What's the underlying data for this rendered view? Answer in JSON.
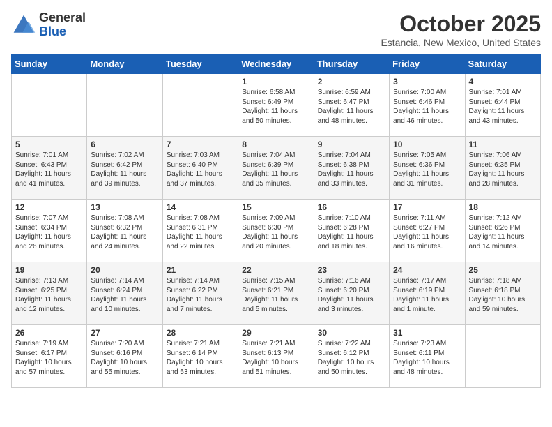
{
  "header": {
    "logo": {
      "line1": "General",
      "line2": "Blue"
    },
    "title": "October 2025",
    "subtitle": "Estancia, New Mexico, United States"
  },
  "weekdays": [
    "Sunday",
    "Monday",
    "Tuesday",
    "Wednesday",
    "Thursday",
    "Friday",
    "Saturday"
  ],
  "weeks": [
    [
      {
        "day": "",
        "sunrise": "",
        "sunset": "",
        "daylight": ""
      },
      {
        "day": "",
        "sunrise": "",
        "sunset": "",
        "daylight": ""
      },
      {
        "day": "",
        "sunrise": "",
        "sunset": "",
        "daylight": ""
      },
      {
        "day": "1",
        "sunrise": "6:58 AM",
        "sunset": "6:49 PM",
        "daylight": "11 hours and 50 minutes."
      },
      {
        "day": "2",
        "sunrise": "6:59 AM",
        "sunset": "6:47 PM",
        "daylight": "11 hours and 48 minutes."
      },
      {
        "day": "3",
        "sunrise": "7:00 AM",
        "sunset": "6:46 PM",
        "daylight": "11 hours and 46 minutes."
      },
      {
        "day": "4",
        "sunrise": "7:01 AM",
        "sunset": "6:44 PM",
        "daylight": "11 hours and 43 minutes."
      }
    ],
    [
      {
        "day": "5",
        "sunrise": "7:01 AM",
        "sunset": "6:43 PM",
        "daylight": "11 hours and 41 minutes."
      },
      {
        "day": "6",
        "sunrise": "7:02 AM",
        "sunset": "6:42 PM",
        "daylight": "11 hours and 39 minutes."
      },
      {
        "day": "7",
        "sunrise": "7:03 AM",
        "sunset": "6:40 PM",
        "daylight": "11 hours and 37 minutes."
      },
      {
        "day": "8",
        "sunrise": "7:04 AM",
        "sunset": "6:39 PM",
        "daylight": "11 hours and 35 minutes."
      },
      {
        "day": "9",
        "sunrise": "7:04 AM",
        "sunset": "6:38 PM",
        "daylight": "11 hours and 33 minutes."
      },
      {
        "day": "10",
        "sunrise": "7:05 AM",
        "sunset": "6:36 PM",
        "daylight": "11 hours and 31 minutes."
      },
      {
        "day": "11",
        "sunrise": "7:06 AM",
        "sunset": "6:35 PM",
        "daylight": "11 hours and 28 minutes."
      }
    ],
    [
      {
        "day": "12",
        "sunrise": "7:07 AM",
        "sunset": "6:34 PM",
        "daylight": "11 hours and 26 minutes."
      },
      {
        "day": "13",
        "sunrise": "7:08 AM",
        "sunset": "6:32 PM",
        "daylight": "11 hours and 24 minutes."
      },
      {
        "day": "14",
        "sunrise": "7:08 AM",
        "sunset": "6:31 PM",
        "daylight": "11 hours and 22 minutes."
      },
      {
        "day": "15",
        "sunrise": "7:09 AM",
        "sunset": "6:30 PM",
        "daylight": "11 hours and 20 minutes."
      },
      {
        "day": "16",
        "sunrise": "7:10 AM",
        "sunset": "6:28 PM",
        "daylight": "11 hours and 18 minutes."
      },
      {
        "day": "17",
        "sunrise": "7:11 AM",
        "sunset": "6:27 PM",
        "daylight": "11 hours and 16 minutes."
      },
      {
        "day": "18",
        "sunrise": "7:12 AM",
        "sunset": "6:26 PM",
        "daylight": "11 hours and 14 minutes."
      }
    ],
    [
      {
        "day": "19",
        "sunrise": "7:13 AM",
        "sunset": "6:25 PM",
        "daylight": "11 hours and 12 minutes."
      },
      {
        "day": "20",
        "sunrise": "7:14 AM",
        "sunset": "6:24 PM",
        "daylight": "11 hours and 10 minutes."
      },
      {
        "day": "21",
        "sunrise": "7:14 AM",
        "sunset": "6:22 PM",
        "daylight": "11 hours and 7 minutes."
      },
      {
        "day": "22",
        "sunrise": "7:15 AM",
        "sunset": "6:21 PM",
        "daylight": "11 hours and 5 minutes."
      },
      {
        "day": "23",
        "sunrise": "7:16 AM",
        "sunset": "6:20 PM",
        "daylight": "11 hours and 3 minutes."
      },
      {
        "day": "24",
        "sunrise": "7:17 AM",
        "sunset": "6:19 PM",
        "daylight": "11 hours and 1 minute."
      },
      {
        "day": "25",
        "sunrise": "7:18 AM",
        "sunset": "6:18 PM",
        "daylight": "10 hours and 59 minutes."
      }
    ],
    [
      {
        "day": "26",
        "sunrise": "7:19 AM",
        "sunset": "6:17 PM",
        "daylight": "10 hours and 57 minutes."
      },
      {
        "day": "27",
        "sunrise": "7:20 AM",
        "sunset": "6:16 PM",
        "daylight": "10 hours and 55 minutes."
      },
      {
        "day": "28",
        "sunrise": "7:21 AM",
        "sunset": "6:14 PM",
        "daylight": "10 hours and 53 minutes."
      },
      {
        "day": "29",
        "sunrise": "7:21 AM",
        "sunset": "6:13 PM",
        "daylight": "10 hours and 51 minutes."
      },
      {
        "day": "30",
        "sunrise": "7:22 AM",
        "sunset": "6:12 PM",
        "daylight": "10 hours and 50 minutes."
      },
      {
        "day": "31",
        "sunrise": "7:23 AM",
        "sunset": "6:11 PM",
        "daylight": "10 hours and 48 minutes."
      },
      {
        "day": "",
        "sunrise": "",
        "sunset": "",
        "daylight": ""
      }
    ]
  ]
}
